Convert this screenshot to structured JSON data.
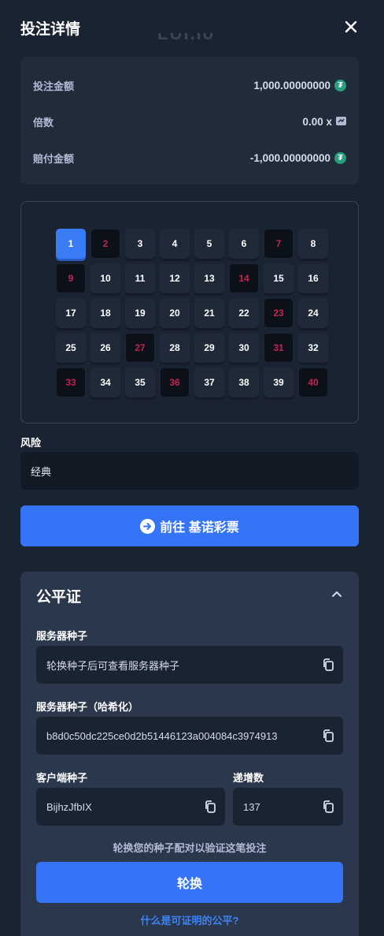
{
  "header": {
    "title": "投注详情",
    "logo_text": "LUI.io"
  },
  "bet_info": {
    "bet_amount_label": "投注金额",
    "bet_amount_value": "1,000.00000000",
    "multiplier_label": "倍数",
    "multiplier_value": "0.00 x",
    "payout_label": "赔付金额",
    "payout_value": "-1,000.00000000",
    "currency_icon": "tether-icon",
    "currency_color": "#26a17b"
  },
  "board": {
    "tiles": [
      {
        "n": "1",
        "state": "selected"
      },
      {
        "n": "2",
        "state": "drawn"
      },
      {
        "n": "3",
        "state": "normal"
      },
      {
        "n": "4",
        "state": "normal"
      },
      {
        "n": "5",
        "state": "normal"
      },
      {
        "n": "6",
        "state": "normal"
      },
      {
        "n": "7",
        "state": "drawn"
      },
      {
        "n": "8",
        "state": "normal"
      },
      {
        "n": "9",
        "state": "drawn"
      },
      {
        "n": "10",
        "state": "normal"
      },
      {
        "n": "11",
        "state": "normal"
      },
      {
        "n": "12",
        "state": "normal"
      },
      {
        "n": "13",
        "state": "normal"
      },
      {
        "n": "14",
        "state": "drawn"
      },
      {
        "n": "15",
        "state": "normal"
      },
      {
        "n": "16",
        "state": "normal"
      },
      {
        "n": "17",
        "state": "normal"
      },
      {
        "n": "18",
        "state": "normal"
      },
      {
        "n": "19",
        "state": "normal"
      },
      {
        "n": "20",
        "state": "normal"
      },
      {
        "n": "21",
        "state": "normal"
      },
      {
        "n": "22",
        "state": "normal"
      },
      {
        "n": "23",
        "state": "drawn"
      },
      {
        "n": "24",
        "state": "normal"
      },
      {
        "n": "25",
        "state": "normal"
      },
      {
        "n": "26",
        "state": "normal"
      },
      {
        "n": "27",
        "state": "drawn"
      },
      {
        "n": "28",
        "state": "normal"
      },
      {
        "n": "29",
        "state": "normal"
      },
      {
        "n": "30",
        "state": "normal"
      },
      {
        "n": "31",
        "state": "drawn"
      },
      {
        "n": "32",
        "state": "normal"
      },
      {
        "n": "33",
        "state": "drawn"
      },
      {
        "n": "34",
        "state": "normal"
      },
      {
        "n": "35",
        "state": "normal"
      },
      {
        "n": "36",
        "state": "drawn"
      },
      {
        "n": "37",
        "state": "normal"
      },
      {
        "n": "38",
        "state": "normal"
      },
      {
        "n": "39",
        "state": "normal"
      },
      {
        "n": "40",
        "state": "drawn"
      }
    ],
    "selected_color": "#3a7bf6",
    "drawn_text_color": "#c0264f"
  },
  "risk": {
    "label": "风险",
    "value": "经典"
  },
  "goto_button": {
    "label": "前往 基诺彩票"
  },
  "fairness": {
    "title": "公平证",
    "server_seed_label": "服务器种子",
    "server_seed_value": "轮换种子后可查看服务器种子",
    "server_seed_hashed_label": "服务器种子（哈希化）",
    "server_seed_hashed_value": "b8d0c50dc225ce0d2b51446123a004084c3974913",
    "client_seed_label": "客户端种子",
    "client_seed_value": "BijhzJfbIX",
    "nonce_label": "递增数",
    "nonce_value": "137",
    "hint": "轮换您的种子配对以验证这笔投注",
    "rotate_label": "轮换",
    "link_text": "什么是可证明的公平?"
  },
  "accent_color": "#3574f6"
}
